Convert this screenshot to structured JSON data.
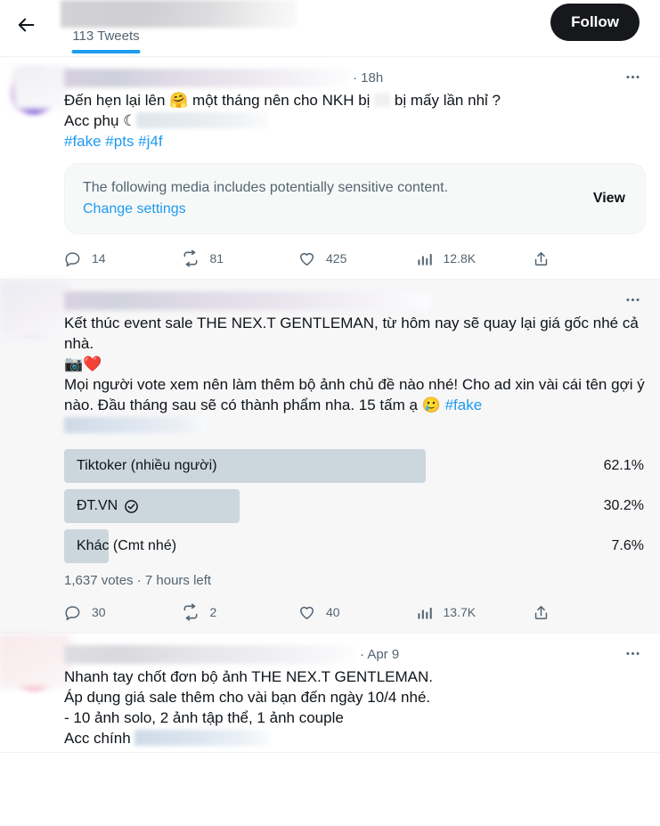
{
  "header": {
    "back_icon": "back-arrow-icon",
    "tab_label": "113 Tweets",
    "follow_label": "Follow",
    "accent_color": "#1d9bf0",
    "follow_bg": "#16181c"
  },
  "tweets": [
    {
      "timestamp": "· 18h",
      "more_icon": "more-horizontal-icon",
      "text_line1_a": "Đến hẹn lại lên ",
      "text_emoji1": "🤗",
      "text_line1_b": " một tháng nên cho NKH bị",
      "text_line1_c": "bị mấy lần nhỉ ?",
      "text_line2": "Acc phụ ☾",
      "hashtags": "#fake #pts #j4f",
      "sensitive": {
        "message": "The following media includes potentially sensitive content.",
        "change_settings": "Change settings",
        "view_label": "View"
      },
      "actions": {
        "reply": "14",
        "retweet": "81",
        "like": "425",
        "views": "12.8K",
        "share": ""
      }
    },
    {
      "timestamp": "",
      "more_icon": "more-horizontal-icon",
      "text_line1": "Kết thúc event sale THE NEX.T GENTLEMAN, từ hôm nay sẽ quay lại giá gốc nhé cả nhà.",
      "text_emoji_row": "📷❤️",
      "text_line2_a": "Mọi người vote xem nên làm thêm bộ ảnh chủ đề nào nhé! Cho ad xin vài cái tên gợi ý nào. Đầu tháng sau sẽ có thành phẩm nha. 15 tấm ạ ",
      "text_emoji2": "🥲",
      "hashtag": "#fake",
      "poll": {
        "options": [
          {
            "label": "Tiktoker (nhiều người)",
            "percent": "62.1%",
            "width_pct": 62.1,
            "voted": false
          },
          {
            "label": "ĐT.VN",
            "percent": "30.2%",
            "width_pct": 30.2,
            "voted": true,
            "check_icon": "check-circle-icon"
          },
          {
            "label": "Khác (Cmt nhé)",
            "percent": "7.6%",
            "width_pct": 7.6,
            "voted": false
          }
        ],
        "meta": "1,637 votes · 7 hours left",
        "bar_color": "#ccd6dd"
      },
      "actions": {
        "reply": "30",
        "retweet": "2",
        "like": "40",
        "views": "13.7K",
        "share": ""
      }
    },
    {
      "timestamp": "· Apr 9",
      "more_icon": "more-horizontal-icon",
      "text_line1": "Nhanh tay chốt đơn bộ ảnh THE NEX.T GENTLEMAN.",
      "text_line2": "Áp dụng giá sale thêm cho vài bạn đến ngày 10/4 nhé.",
      "text_line3": "- 10 ảnh solo, 2 ảnh tập thể, 1 ảnh couple",
      "text_line4": "Acc chính"
    }
  ],
  "icons": {
    "reply": "reply-icon",
    "retweet": "retweet-icon",
    "like": "heart-icon",
    "views": "analytics-icon",
    "share": "share-icon"
  }
}
